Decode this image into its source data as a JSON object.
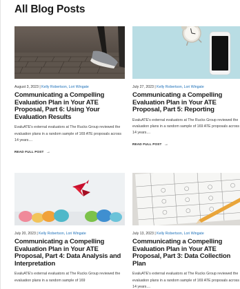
{
  "page": {
    "title": "All Blog Posts"
  },
  "posts": [
    {
      "date": "August 3, 2023",
      "separator": "|",
      "authors": "Kelly Robertson, Lori Wingate",
      "title": "Communicating a Compelling Evaluation Plan in Your ATE Proposal, Part 6: Using Your Evaluation Results",
      "excerpt": "EvaluATE's external evaluators at The Rucks Group reviewed the evaluation plans in a random sample of 169 ATE proposals across 14 years....",
      "read_more": "READ FULL POST",
      "image": "runner-feet-on-brick-path"
    },
    {
      "date": "July 27, 2023",
      "separator": "|",
      "authors": "Kelly Robertson, Lori Wingate",
      "title": "Communicating a Compelling Evaluation Plan in Your ATE Proposal, Part 5: Reporting",
      "excerpt": "EvaluATE's external evaluators at The Rucks Group reviewed the evaluation plans in a random sample of 169 ATE proposals across 14 years....",
      "read_more": "READ FULL POST",
      "image": "alarm-clock-and-smartphone"
    },
    {
      "date": "July 20, 2023",
      "separator": "|",
      "authors": "Kelly Robertson, Lori Wingate",
      "title": "Communicating a Compelling Evaluation Plan in Your ATE Proposal, Part 4: Data Analysis and Interpretation",
      "excerpt": "EvaluATE's external evaluators at The Rucks Group reviewed the evaluation plans in a random sample of 169",
      "read_more": "",
      "image": "paper-crane-and-crumpled-paper"
    },
    {
      "date": "July 13, 2023",
      "separator": "|",
      "authors": "Kelly Robertson, Lori Wingate",
      "title": "Communicating a Compelling Evaluation Plan in Your ATE Proposal, Part 3: Data Collection Plan",
      "excerpt": "EvaluATE's external evaluators at The Rucks Group reviewed the evaluation plans in a random sample of 169 ATE proposals across 14 years....",
      "read_more": "",
      "image": "survey-form-with-pencil"
    }
  ],
  "icons": {
    "read_more_arrow": "→"
  },
  "colors": {
    "author_link": "#1b6fb8",
    "heading": "#1a1a1a"
  }
}
